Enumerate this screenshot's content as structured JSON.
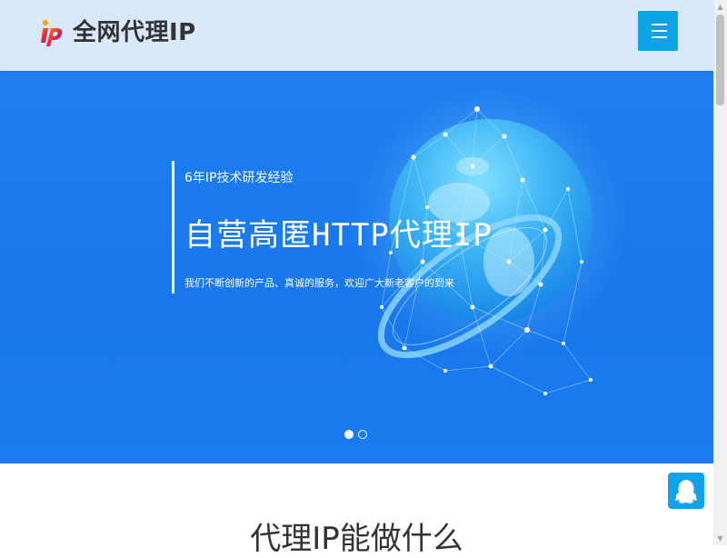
{
  "header": {
    "brand": "全网代理IP",
    "logo_text": "ip",
    "menu_icon": "hamburger-menu-icon"
  },
  "banner": {
    "subtitle": "6年IP技术研发经验",
    "title": "自营高匿HTTP代理IP",
    "description": "我们不断创新的产品、真诚的服务，欢迎广大新老客户的到来",
    "slides_total": 2,
    "slide_active": 1
  },
  "section": {
    "title": "代理IP能做什么"
  },
  "floating": {
    "qq_icon": "qq-penguin-icon"
  },
  "colors": {
    "header_bg": "#d9e8fb",
    "banner_bg": "#1f7ef0",
    "accent": "#0ea2e6"
  }
}
